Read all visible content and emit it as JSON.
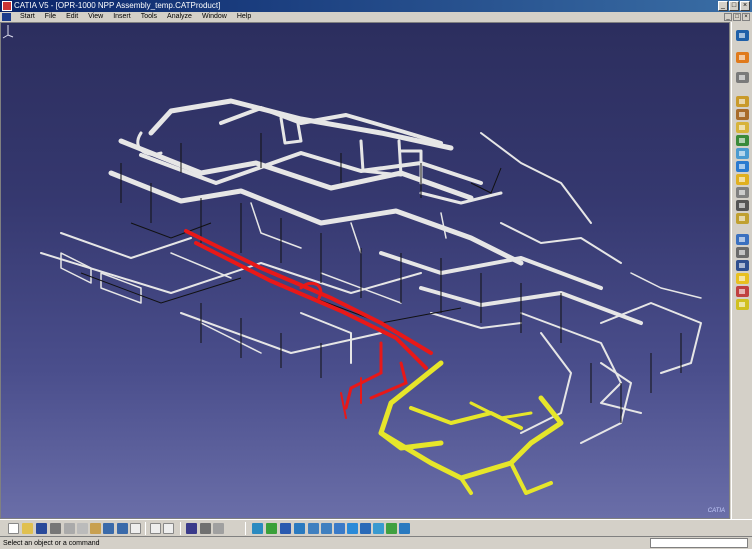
{
  "window": {
    "title": "CATIA V5 - [OPR-1000 NPP Assembly_temp.CATProduct]",
    "controls": [
      "_",
      "□",
      "×"
    ]
  },
  "menu": {
    "items": [
      "Start",
      "File",
      "Edit",
      "View",
      "Insert",
      "Tools",
      "Analyze",
      "Window",
      "Help"
    ],
    "mdi_controls": [
      "_",
      "□",
      "×"
    ]
  },
  "status": {
    "message": "Select an object or a command"
  },
  "colors": {
    "viewport_top": "#2c2e5e",
    "viewport_bottom": "#6a6ea8",
    "pipe_default": "#e8e8e8",
    "pipe_highlight_red": "#e81818",
    "pipe_highlight_yellow": "#e6e62a"
  },
  "right_toolbar_icons": [
    "select-icon",
    "sketch-icon",
    "rotate-icon",
    "product-icon",
    "part-icon",
    "component-icon",
    "replace-icon",
    "graph-icon",
    "reorder-icon",
    "numbering-icon",
    "constraint-icon",
    "snap-icon",
    "explode-icon",
    "clash-icon",
    "section-icon",
    "measure-icon",
    "catalog-icon",
    "scene-icon",
    "bulb-icon",
    "cut-icon"
  ],
  "bottom_toolbar_icons": [
    "new-icon",
    "open-icon",
    "save-icon",
    "print-icon",
    "cut-icon",
    "copy-icon",
    "paste-icon",
    "undo-icon",
    "redo-icon",
    "whats-this-icon",
    "formula-icon",
    "comment-icon",
    "catalog-icon",
    "material-icon",
    "apply-icon",
    "hide-icon",
    "fly-icon",
    "fit-all-icon",
    "pan-icon",
    "rotate-view-icon",
    "zoom-in-icon",
    "zoom-out-icon",
    "normal-view-icon",
    "iso-view-icon",
    "multi-view-icon",
    "render-icon",
    "swap-icon",
    "shading-icon"
  ]
}
